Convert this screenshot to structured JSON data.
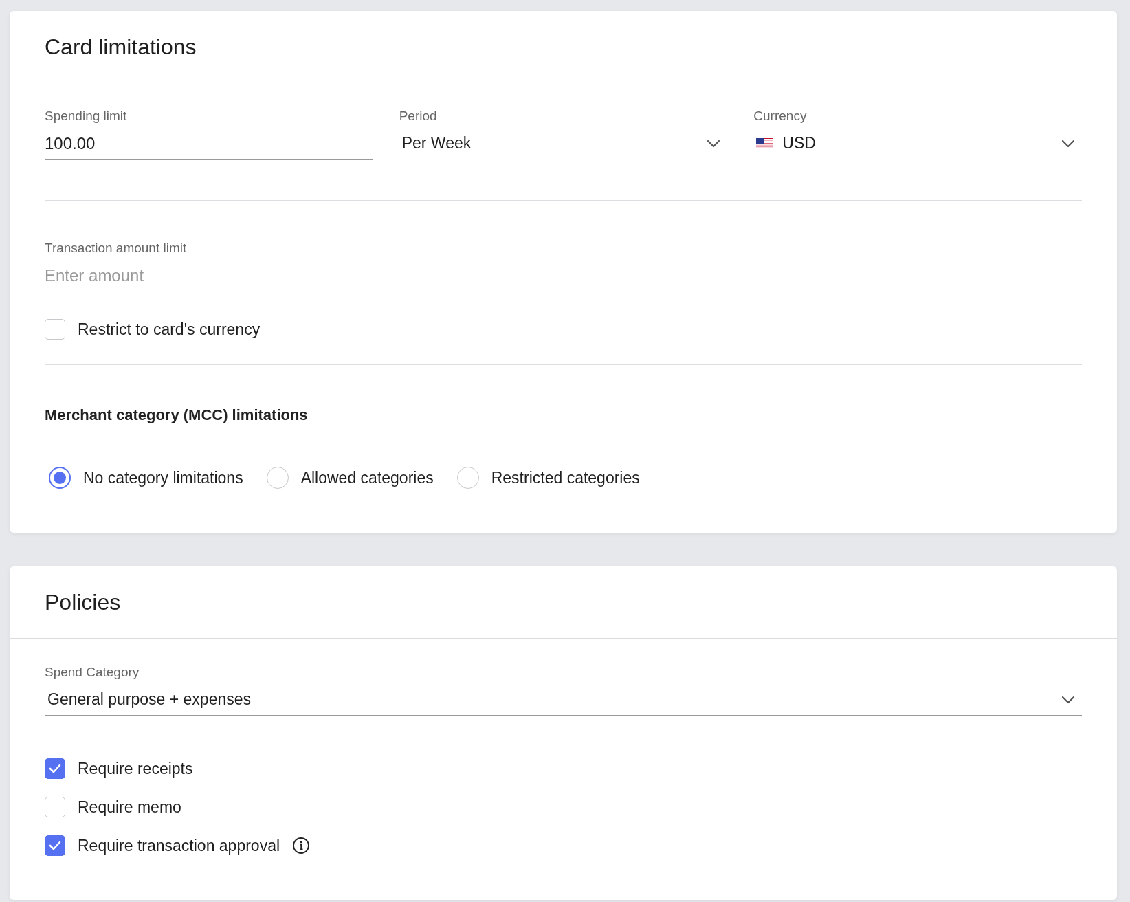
{
  "card_limitations": {
    "title": "Card limitations",
    "spending_limit": {
      "label": "Spending limit",
      "value": "100.00"
    },
    "period": {
      "label": "Period",
      "value": "Per Week"
    },
    "currency": {
      "label": "Currency",
      "value": "USD"
    },
    "transaction_limit": {
      "label": "Transaction amount limit",
      "placeholder": "Enter amount"
    },
    "restrict_currency": {
      "label": "Restrict to card's currency",
      "checked": false
    },
    "mcc": {
      "heading": "Merchant category (MCC) limitations",
      "options": [
        {
          "label": "No category limitations",
          "selected": true
        },
        {
          "label": "Allowed categories",
          "selected": false
        },
        {
          "label": "Restricted categories",
          "selected": false
        }
      ]
    }
  },
  "policies": {
    "title": "Policies",
    "spend_category": {
      "label": "Spend Category",
      "value": "General purpose + expenses"
    },
    "requirements": [
      {
        "label": "Require receipts",
        "checked": true,
        "info": false
      },
      {
        "label": "Require memo",
        "checked": false,
        "info": false
      },
      {
        "label": "Require transaction approval",
        "checked": true,
        "info": true
      }
    ]
  }
}
